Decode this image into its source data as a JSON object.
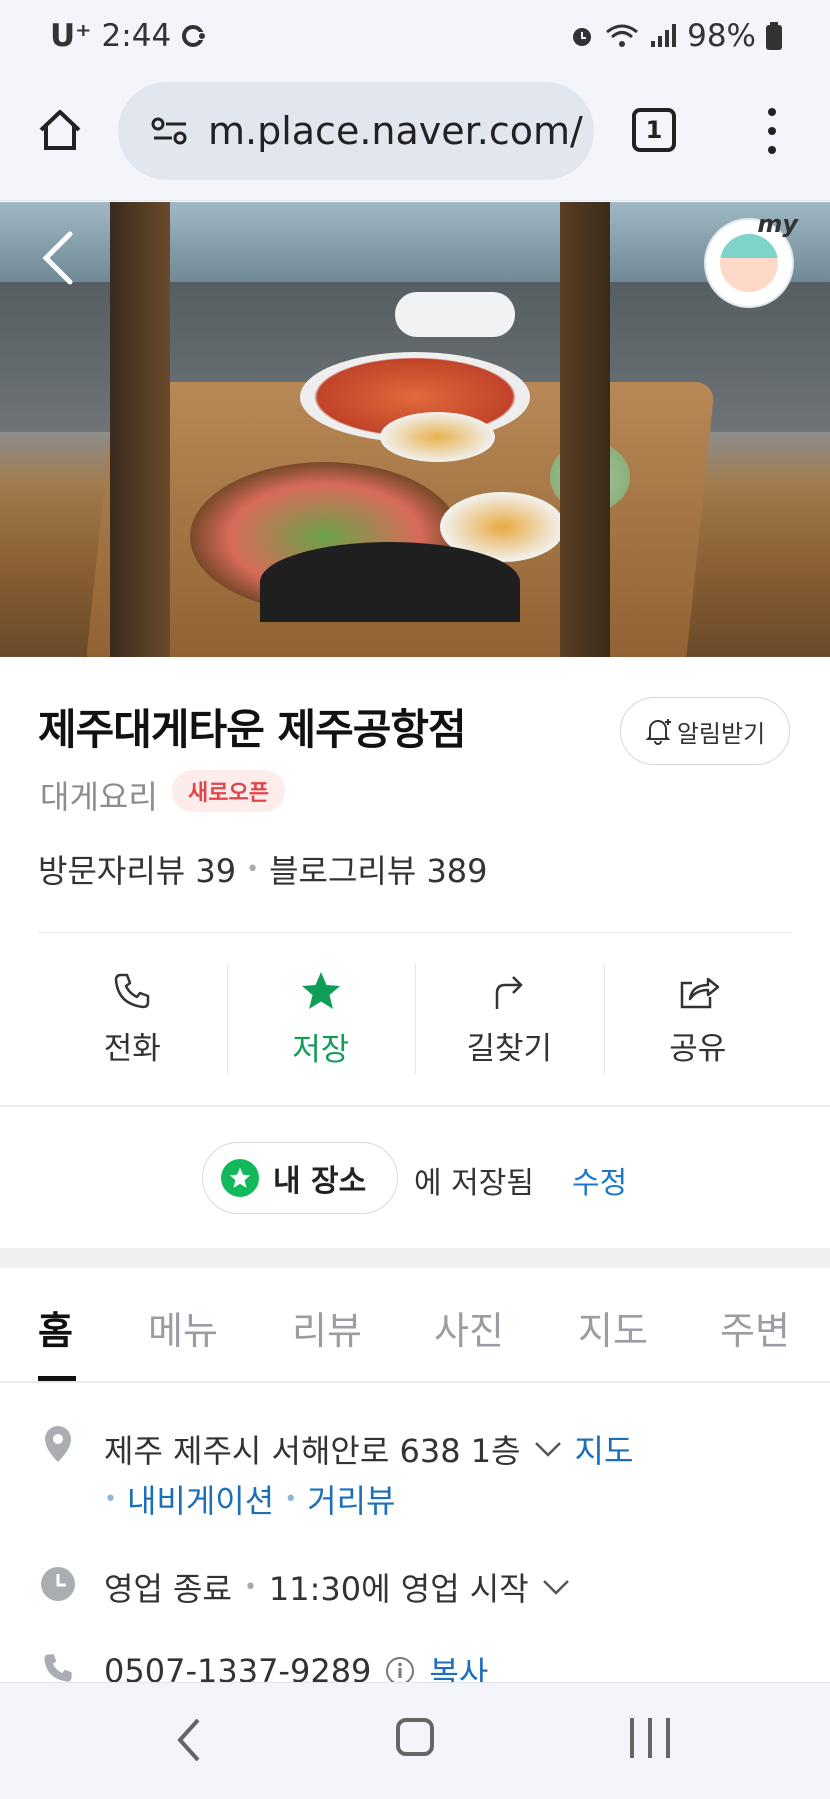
{
  "status_bar": {
    "carrier": "U⁺",
    "time": "2:44",
    "battery": "98%"
  },
  "browser": {
    "url": "m.place.naver.com/",
    "tab_count": "1"
  },
  "place": {
    "name": "제주대게타운 제주공항점",
    "notify_label": "알림받기",
    "category": "대게요리",
    "badge": "새로오픈",
    "visitor_reviews": "방문자리뷰 39",
    "blog_reviews": "블로그리뷰 389"
  },
  "actions": [
    {
      "label": "전화",
      "icon": "phone-icon"
    },
    {
      "label": "저장",
      "icon": "star-icon",
      "active": true
    },
    {
      "label": "길찾기",
      "icon": "directions-icon"
    },
    {
      "label": "공유",
      "icon": "share-icon"
    }
  ],
  "saved": {
    "list_name": "내 장소",
    "saved_text": "에 저장됨",
    "edit_label": "수정"
  },
  "tabs": [
    "홈",
    "메뉴",
    "리뷰",
    "사진",
    "지도",
    "주변"
  ],
  "active_tab": "홈",
  "info": {
    "address": "제주 제주시 서해안로 638 1층",
    "map_link": "지도",
    "navigation_link": "내비게이션",
    "street_view_link": "거리뷰",
    "status": "영업 종료",
    "open_time": "11:30에 영업 시작",
    "phone": "0507-1337-9289",
    "copy_label": "복사"
  },
  "colors": {
    "accent_green": "#0f9d58",
    "link_blue": "#1c6fb8",
    "badge_red": "#e0464a"
  }
}
